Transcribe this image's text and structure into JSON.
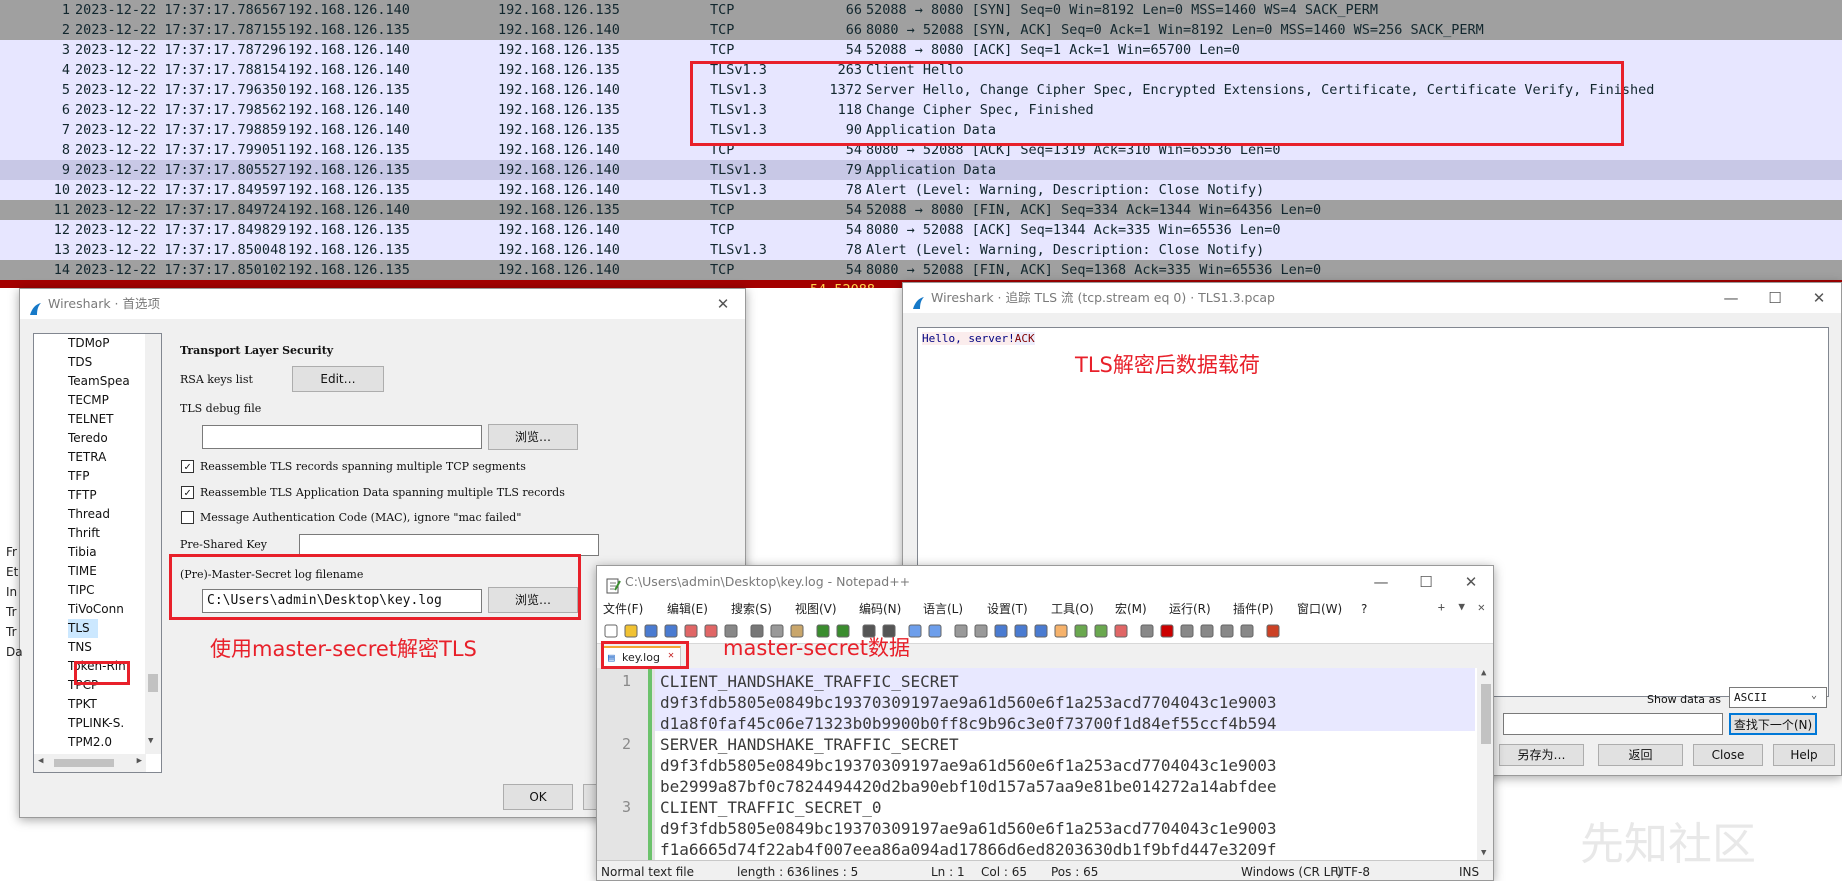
{
  "colors": {
    "row_tcp_light": "#e7e6ff",
    "row_tcp_dark": "#a0a0a0",
    "row_error": "#a40000",
    "annotation_red": "#e8202a"
  },
  "packets": [
    {
      "no": "1",
      "time": "2023-12-22 17:37:17.786567",
      "src": "192.168.126.140",
      "dst": "192.168.126.135",
      "proto": "TCP",
      "len": "66",
      "info": "52088 → 8080 [SYN] Seq=0 Win=8192 Len=0 MSS=1460 WS=4 SACK_PERM",
      "bg": "#a0a0a0"
    },
    {
      "no": "2",
      "time": "2023-12-22 17:37:17.787155",
      "src": "192.168.126.135",
      "dst": "192.168.126.140",
      "proto": "TCP",
      "len": "66",
      "info": "8080 → 52088 [SYN, ACK] Seq=0 Ack=1 Win=8192 Len=0 MSS=1460 WS=256 SACK_PERM",
      "bg": "#a0a0a0"
    },
    {
      "no": "3",
      "time": "2023-12-22 17:37:17.787296",
      "src": "192.168.126.140",
      "dst": "192.168.126.135",
      "proto": "TCP",
      "len": "54",
      "info": "52088 → 8080 [ACK] Seq=1 Ack=1 Win=65700 Len=0",
      "bg": "#e7e6ff"
    },
    {
      "no": "4",
      "time": "2023-12-22 17:37:17.788154",
      "src": "192.168.126.140",
      "dst": "192.168.126.135",
      "proto": "TLSv1.3",
      "len": "263",
      "info": "Client Hello",
      "bg": "#e7e6ff"
    },
    {
      "no": "5",
      "time": "2023-12-22 17:37:17.796350",
      "src": "192.168.126.135",
      "dst": "192.168.126.140",
      "proto": "TLSv1.3",
      "len": "1372",
      "info": "Server Hello, Change Cipher Spec, Encrypted Extensions, Certificate, Certificate Verify, Finished",
      "bg": "#e7e6ff"
    },
    {
      "no": "6",
      "time": "2023-12-22 17:37:17.798562",
      "src": "192.168.126.140",
      "dst": "192.168.126.135",
      "proto": "TLSv1.3",
      "len": "118",
      "info": "Change Cipher Spec, Finished",
      "bg": "#e7e6ff"
    },
    {
      "no": "7",
      "time": "2023-12-22 17:37:17.798859",
      "src": "192.168.126.140",
      "dst": "192.168.126.135",
      "proto": "TLSv1.3",
      "len": "90",
      "info": "Application Data",
      "bg": "#e7e6ff"
    },
    {
      "no": "8",
      "time": "2023-12-22 17:37:17.799051",
      "src": "192.168.126.135",
      "dst": "192.168.126.140",
      "proto": "TCP",
      "len": "54",
      "info": "8080 → 52088 [ACK] Seq=1319 Ack=310 Win=65536 Len=0",
      "bg": "#e7e6ff"
    },
    {
      "no": "9",
      "time": "2023-12-22 17:37:17.805527",
      "src": "192.168.126.135",
      "dst": "192.168.126.140",
      "proto": "TLSv1.3",
      "len": "79",
      "info": "Application Data",
      "bg": "#c8c8e6"
    },
    {
      "no": "10",
      "time": "2023-12-22 17:37:17.849597",
      "src": "192.168.126.135",
      "dst": "192.168.126.140",
      "proto": "TLSv1.3",
      "len": "78",
      "info": "Alert (Level: Warning, Description: Close Notify)",
      "bg": "#e7e6ff"
    },
    {
      "no": "11",
      "time": "2023-12-22 17:37:17.849724",
      "src": "192.168.126.140",
      "dst": "192.168.126.135",
      "proto": "TCP",
      "len": "54",
      "info": "52088 → 8080 [FIN, ACK] Seq=334 Ack=1344 Win=64356 Len=0",
      "bg": "#a0a0a0"
    },
    {
      "no": "12",
      "time": "2023-12-22 17:37:17.849829",
      "src": "192.168.126.135",
      "dst": "192.168.126.140",
      "proto": "TCP",
      "len": "54",
      "info": "8080 → 52088 [ACK] Seq=1344 Ack=335 Win=65536 Len=0",
      "bg": "#e7e6ff"
    },
    {
      "no": "13",
      "time": "2023-12-22 17:37:17.850048",
      "src": "192.168.126.135",
      "dst": "192.168.126.140",
      "proto": "TLSv1.3",
      "len": "78",
      "info": "Alert (Level: Warning, Description: Close Notify)",
      "bg": "#e7e6ff"
    },
    {
      "no": "14",
      "time": "2023-12-22 17:37:17.850102",
      "src": "192.168.126.135",
      "dst": "192.168.126.140",
      "proto": "TCP",
      "len": "54",
      "info": "8080 → 52088 [FIN, ACK] Seq=1368 Ack=335 Win=65536 Len=0",
      "bg": "#a0a0a0"
    }
  ],
  "error_rows": [
    "54 52088 →",
    "54 52088 →"
  ],
  "prefs": {
    "title": "Wireshark · 首选项",
    "tree": [
      "TDMoP",
      "TDS",
      "TeamSpea",
      "TECMP",
      "TELNET",
      "Teredo",
      "TETRA",
      "TFP",
      "TFTP",
      "Thread",
      "Thrift",
      "Tibia",
      "TIME",
      "TIPC",
      "TiVoConn",
      "TLS",
      "TNS",
      "Token-Rin",
      "TPCP",
      "TPKT",
      "TPLINK-S.",
      "TPM2.0"
    ],
    "tree_selected": "TLS",
    "section_title": "Transport Layer Security",
    "rsa_label": "RSA keys list",
    "edit_btn": "Edit…",
    "debug_label": "TLS debug file",
    "browse_btn": "浏览…",
    "chk1": "Reassemble TLS records spanning multiple TCP segments",
    "chk2": "Reassemble TLS Application Data spanning multiple TLS records",
    "chk3": "Message Authentication Code (MAC), ignore \"mac failed\"",
    "psk_label": "Pre-Shared Key",
    "master_label": "(Pre)-Master-Secret log filename",
    "master_value": "C:\\Users\\admin\\Desktop\\key.log",
    "ok_btn": "OK",
    "side_letters": [
      "Fr",
      "Et",
      "In",
      "Tr",
      "Tr",
      "Da"
    ]
  },
  "follow": {
    "title": "Wireshark · 追踪 TLS 流 (tcp.stream eq 0) · TLS1.3.pcap",
    "client_text": "Hello, server!",
    "server_text": "ACK",
    "show_data_label": "Show data as",
    "show_data_value": "ASCII",
    "find_next_btn": "查找下一个(N)",
    "save_as_btn": "另存为…",
    "back_btn": "返回",
    "close_btn": "Close",
    "help_btn": "Help"
  },
  "notepad": {
    "title": "C:\\Users\\admin\\Desktop\\key.log - Notepad++",
    "menus": [
      "文件(F)",
      "编辑(E)",
      "搜索(S)",
      "视图(V)",
      "编码(N)",
      "语言(L)",
      "设置(T)",
      "工具(O)",
      "宏(M)",
      "运行(R)",
      "插件(P)",
      "窗口(W)",
      "?"
    ],
    "tab_label": "key.log",
    "lines": [
      {
        "num": "1",
        "text": "CLIENT_HANDSHAKE_TRAFFIC_SECRET"
      },
      {
        "num": "",
        "text": "d9f3fdb5805e0849bc19370309197ae9a61d560e6f1a253acd7704043c1e9003"
      },
      {
        "num": "",
        "text": "d1a8f0faf45c06e71323b0b9900b0ff8c9b96c3e0f73700f1d84ef55ccf4b594"
      },
      {
        "num": "2",
        "text": "SERVER_HANDSHAKE_TRAFFIC_SECRET"
      },
      {
        "num": "",
        "text": "d9f3fdb5805e0849bc19370309197ae9a61d560e6f1a253acd7704043c1e9003"
      },
      {
        "num": "",
        "text": "be2999a87bf0c7824494420d2ba90ebf10d157a57aa9e81be014272a14abfdee"
      },
      {
        "num": "3",
        "text": "CLIENT_TRAFFIC_SECRET_0"
      },
      {
        "num": "",
        "text": "d9f3fdb5805e0849bc19370309197ae9a61d560e6f1a253acd7704043c1e9003"
      },
      {
        "num": "",
        "text": "f1a6665d74f22ab4f007eea86a094ad17866d6ed8203630db1f9bfd447e3209f"
      }
    ],
    "status": {
      "type": "Normal text file",
      "length": "length : 636",
      "lines": "lines : 5",
      "ln": "Ln : 1",
      "col": "Col : 65",
      "pos": "Pos : 65",
      "eol": "Windows (CR LF)",
      "enc": "UTF-8",
      "ins": "INS"
    }
  },
  "annotations": {
    "tls_payload": "TLS解密后数据载荷",
    "use_master": "使用master-secret解密TLS",
    "master_data": "master-secret数据"
  },
  "watermark": "先知社区"
}
